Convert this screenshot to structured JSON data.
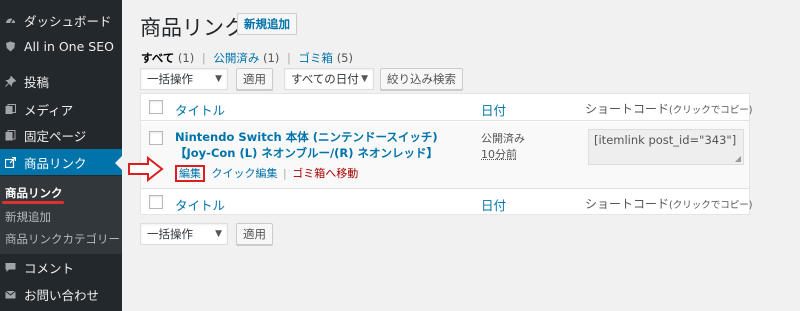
{
  "colors": {
    "sidebar": "#23282d",
    "active": "#0073aa",
    "link": "#0073aa",
    "highlight": "#dd1e1e",
    "trash": "#a00"
  },
  "sidebar": {
    "items": [
      {
        "label": "ダッシュボード",
        "icon": "dashboard-icon"
      },
      {
        "label": "All in One SEO",
        "icon": "shield-icon"
      },
      {
        "label": "投稿",
        "icon": "pin-icon"
      },
      {
        "label": "メディア",
        "icon": "media-icon"
      },
      {
        "label": "固定ページ",
        "icon": "page-icon"
      },
      {
        "label": "商品リンク",
        "icon": "link-icon"
      },
      {
        "label": "コメント",
        "icon": "comment-icon"
      },
      {
        "label": "お問い合わせ",
        "icon": "mail-icon"
      }
    ],
    "submenu": [
      "商品リンク",
      "新規追加",
      "商品リンクカテゴリー"
    ]
  },
  "header": {
    "title": "商品リンク",
    "add_new": "新規追加"
  },
  "filters": {
    "all": "すべて",
    "all_count": "(1)",
    "published": "公開済み",
    "published_count": "(1)",
    "trash": "ゴミ箱",
    "trash_count": "(5)",
    "sep": "|"
  },
  "toolbar": {
    "bulk_action": "一括操作",
    "apply": "適用",
    "date_filter": "すべての日付",
    "filter_button": "絞り込み検索"
  },
  "table": {
    "columns": {
      "title": "タイトル",
      "date": "日付",
      "shortcode": "ショートコード",
      "shortcode_note": "(クリックでコピー)"
    },
    "rows": [
      {
        "title": "Nintendo Switch 本体 (ニンテンドースイッチ) 【Joy-Con (L) ネオンブルー/(R) ネオンレッド】",
        "actions": {
          "edit": "編集",
          "quick_edit": "クイック編集",
          "sep": "|",
          "trash": "ゴミ箱へ移動"
        },
        "status": "公開済み",
        "ago": "10分前",
        "shortcode": "[itemlink post_id=\"343\"]"
      }
    ]
  },
  "bottom_toolbar": {
    "bulk_action": "一括操作",
    "apply": "適用"
  }
}
